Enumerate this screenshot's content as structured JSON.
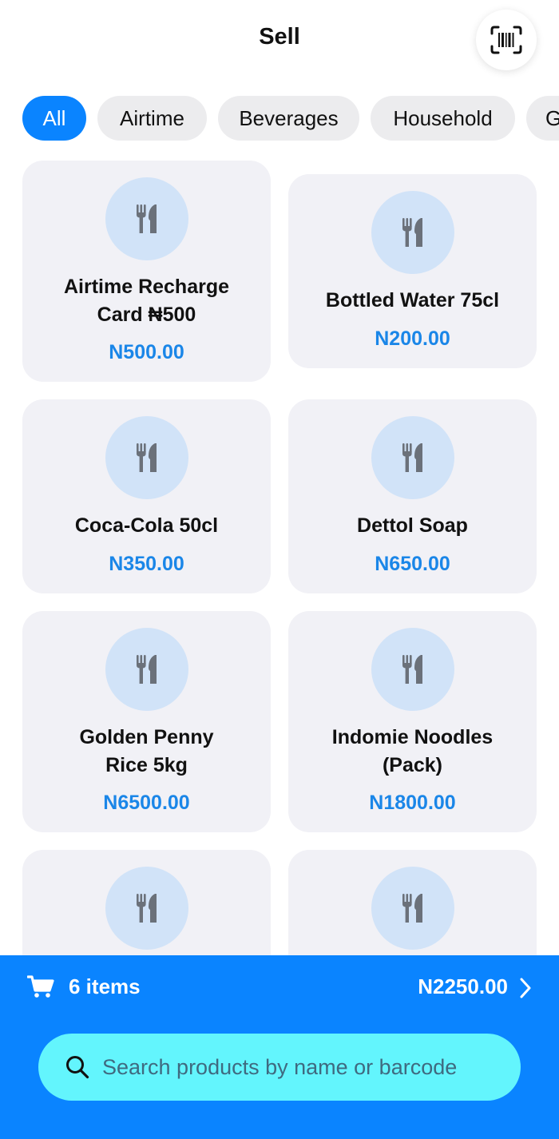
{
  "header": {
    "title": "Sell",
    "scan_icon": "barcode-scan-icon"
  },
  "categories": [
    {
      "label": "All",
      "active": true
    },
    {
      "label": "Airtime",
      "active": false
    },
    {
      "label": "Beverages",
      "active": false
    },
    {
      "label": "Household",
      "active": false
    },
    {
      "label": "G",
      "active": false
    }
  ],
  "products": [
    {
      "name_line1": "Airtime Recharge",
      "name_line2": "Card ₦500",
      "price": "N500.00",
      "icon": "fork-knife-icon"
    },
    {
      "name_line1": "Bottled Water 75cl",
      "name_line2": "",
      "price": "N200.00",
      "icon": "fork-knife-icon"
    },
    {
      "name_line1": "Coca-Cola 50cl",
      "name_line2": "",
      "price": "N350.00",
      "icon": "fork-knife-icon"
    },
    {
      "name_line1": "Dettol Soap",
      "name_line2": "",
      "price": "N650.00",
      "icon": "fork-knife-icon"
    },
    {
      "name_line1": "Golden Penny",
      "name_line2": "Rice 5kg",
      "price": "N6500.00",
      "icon": "fork-knife-icon"
    },
    {
      "name_line1": "Indomie Noodles",
      "name_line2": "(Pack)",
      "price": "N1800.00",
      "icon": "fork-knife-icon"
    },
    {
      "name_line1": "",
      "name_line2": "",
      "price": "",
      "icon": "fork-knife-icon"
    },
    {
      "name_line1": "",
      "name_line2": "",
      "price": "",
      "icon": "fork-knife-icon"
    }
  ],
  "cart": {
    "count_label": "6 items",
    "total": "N2250.00"
  },
  "search": {
    "placeholder": "Search products by name or barcode",
    "value": ""
  },
  "colors": {
    "accent": "#0a84ff",
    "price": "#1a86e8",
    "search_bg": "#63f5fd",
    "card_bg": "#f1f1f6",
    "icon_circle": "#d1e3f8"
  }
}
